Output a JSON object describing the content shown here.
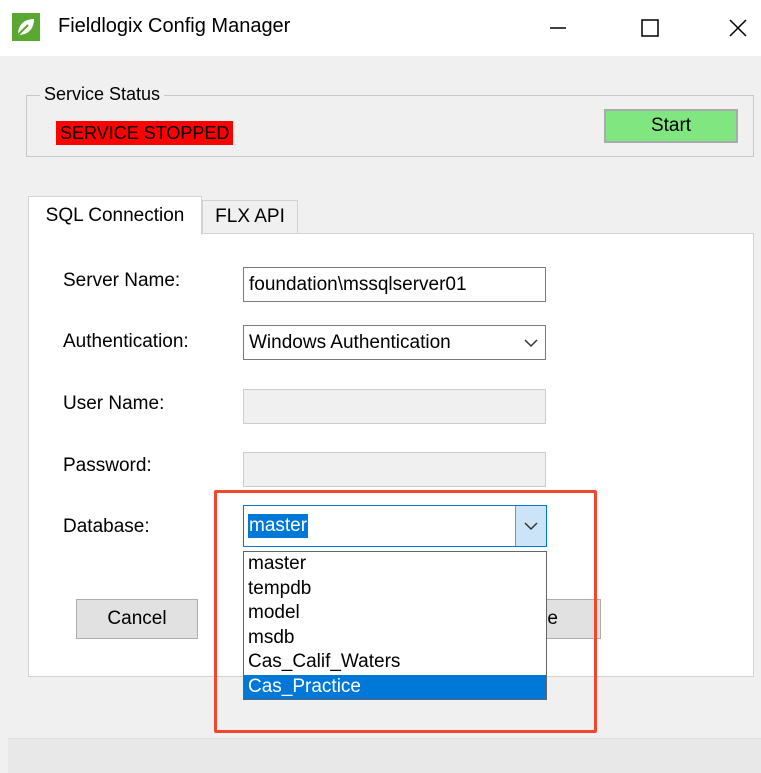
{
  "window": {
    "title": "Fieldlogix Config Manager"
  },
  "service_status": {
    "legend": "Service Status",
    "status_text": "SERVICE STOPPED",
    "status_color": "#ff0000",
    "start_label": "Start",
    "start_color": "#80e680"
  },
  "tabs": [
    {
      "label": "SQL Connection",
      "active": true
    },
    {
      "label": "FLX API",
      "active": false
    }
  ],
  "form": {
    "server_name": {
      "label": "Server Name:",
      "value": "foundation\\mssqlserver01"
    },
    "authentication": {
      "label": "Authentication:",
      "value": "Windows Authentication"
    },
    "user_name": {
      "label": "User Name:",
      "value": ""
    },
    "password": {
      "label": "Password:",
      "value": ""
    },
    "database": {
      "label": "Database:",
      "value": "master",
      "options": [
        "master",
        "tempdb",
        "model",
        "msdb",
        "Cas_Calif_Waters",
        "Cas_Practice"
      ],
      "highlighted_option": "Cas_Practice"
    }
  },
  "buttons": {
    "cancel_label": "Cancel",
    "save_label_visible": "e"
  },
  "icons": {
    "app": "leaf-icon",
    "minimize": "minimize-icon",
    "maximize": "maximize-icon",
    "close": "close-icon",
    "dropdown": "chevron-down-icon"
  },
  "accent_color": "#0078d7",
  "annotation_color": "#f0472d"
}
